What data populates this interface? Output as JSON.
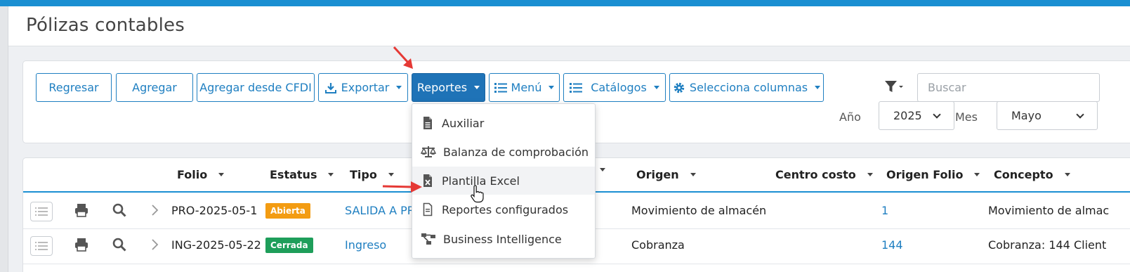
{
  "page": {
    "title": "Pólizas contables"
  },
  "toolbar": {
    "buttons": [
      "Regresar",
      "Agregar",
      "Agregar desde CFDI",
      "Exportar",
      "Reportes",
      "Menú",
      "Catálogos",
      "Selecciona columnas"
    ],
    "search_placeholder": "Buscar",
    "year_label": "Año",
    "year_value": "2025",
    "month_label": "Mes",
    "month_value": "Mayo"
  },
  "reports_menu": {
    "items": [
      "Auxiliar",
      "Balanza de comprobación",
      "Plantilla Excel",
      "Reportes configurados",
      "Business Intelligence"
    ],
    "hovered_item": "Plantilla Excel"
  },
  "table": {
    "columns": [
      "Folio",
      "Estatus",
      "Tipo",
      "Origen",
      "Centro costo",
      "Origen Folio",
      "Concepto"
    ],
    "rows": [
      {
        "folio": "PRO-2025-05-1",
        "estatus": "Abierta",
        "tipo": "SALIDA A PRO",
        "origen": "Movimiento de almacén",
        "centro_costo": "",
        "origen_folio": "1",
        "concepto": "Movimiento de almac"
      },
      {
        "folio": "ING-2025-05-22",
        "estatus": "Cerrada",
        "tipo": "Ingreso",
        "origen": "Cobranza",
        "centro_costo": "",
        "origen_folio": "144",
        "concepto": "Cobranza: 144 Client"
      }
    ]
  },
  "colors": {
    "brand": "#1b8fd2",
    "primary_button": "#1f73b7",
    "link": "#1f7fc1",
    "abierta": "#f39c12",
    "cerrada": "#1e9e5a",
    "annotation_arrow": "#e53935"
  }
}
